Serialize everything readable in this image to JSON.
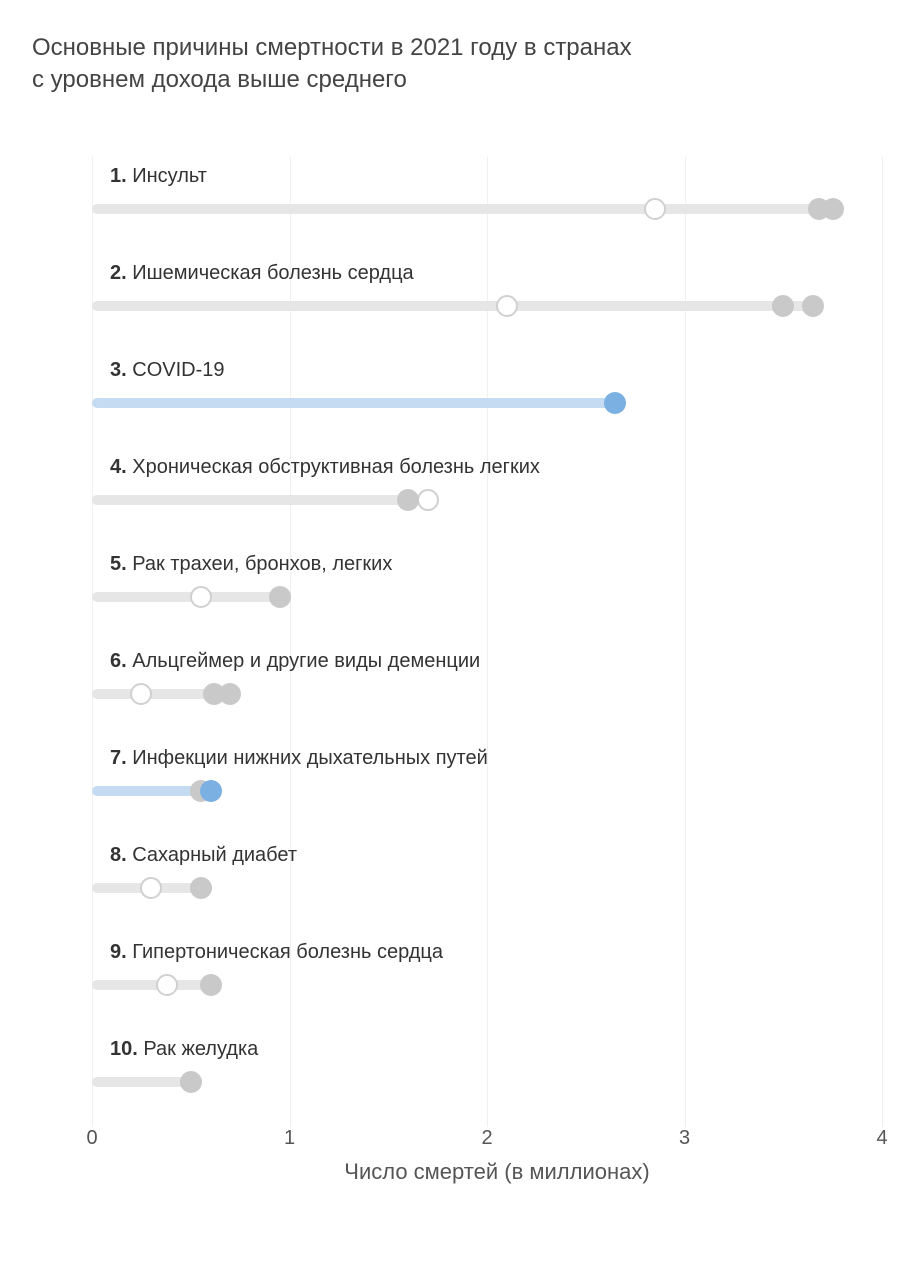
{
  "title_line1": "Основные причины смертности в 2021 году в странах",
  "title_line2": "с уровнем дохода выше среднего",
  "chart_data": {
    "type": "bar",
    "xlabel": "Число смертей (в миллионах)",
    "ylabel": "",
    "xlim": [
      0,
      4
    ],
    "ticks": [
      0,
      1,
      2,
      3,
      4
    ],
    "categories": [
      "Инсульт",
      "Ишемическая болезнь сердца",
      "COVID-19",
      "Хроническая обструктивная болезнь легких",
      "Рак трахеи, бронхов, легких",
      "Альцгеймер и другие виды деменции",
      "Инфекции нижних дыхательных путей",
      "Сахарный диабет",
      "Гипертоническая болезнь сердца",
      "Рак желудка"
    ],
    "rows": [
      {
        "rank": "1.",
        "label": "Инсульт",
        "value": 3.75,
        "extra_grey": 3.68,
        "open": 2.85,
        "highlight": false
      },
      {
        "rank": "2.",
        "label": "Ишемическая болезнь сердца",
        "value": 3.65,
        "extra_grey": 3.5,
        "open": 2.1,
        "highlight": false
      },
      {
        "rank": "3.",
        "label": "COVID-19",
        "value": 2.65,
        "extra_grey": null,
        "open": null,
        "highlight": true
      },
      {
        "rank": "4.",
        "label": "Хроническая обструктивная болезнь легких",
        "value": 1.6,
        "extra_grey": null,
        "open": 1.7,
        "highlight": false
      },
      {
        "rank": "5.",
        "label": "Рак трахеи, бронхов, легких",
        "value": 0.95,
        "extra_grey": null,
        "open": 0.55,
        "highlight": false
      },
      {
        "rank": "6.",
        "label": "Альцгеймер и другие виды деменции",
        "value": 0.7,
        "extra_grey": 0.62,
        "open": 0.25,
        "highlight": false
      },
      {
        "rank": "7.",
        "label": "Инфекции нижних дыхательных путей",
        "value": 0.6,
        "extra_grey": 0.55,
        "open": null,
        "highlight": true
      },
      {
        "rank": "8.",
        "label": "Сахарный диабет",
        "value": 0.55,
        "extra_grey": null,
        "open": 0.3,
        "highlight": false
      },
      {
        "rank": "9.",
        "label": "Гипертоническая болезнь сердца",
        "value": 0.6,
        "extra_grey": null,
        "open": 0.38,
        "highlight": false
      },
      {
        "rank": "10.",
        "label": "Рак желудка",
        "value": 0.5,
        "extra_grey": null,
        "open": null,
        "highlight": false
      }
    ]
  },
  "colors": {
    "bar_grey": "#e6e6e6",
    "bar_blue": "#c5dbf2",
    "dot_grey": "#c9c9c9",
    "dot_blue": "#7bb0e3",
    "dot_open_border": "#d0d0d0"
  }
}
